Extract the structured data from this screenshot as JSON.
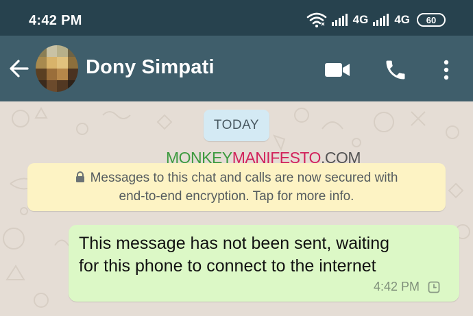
{
  "status_bar": {
    "time": "4:42 PM",
    "network_1": "4G",
    "network_2": "4G",
    "battery": "60",
    "icons": [
      "wifi-icon",
      "signal-icon",
      "signal-icon",
      "battery-icon"
    ]
  },
  "header": {
    "contact_name": "Dony Simpati",
    "icons": [
      "back-arrow-icon",
      "video-call-icon",
      "phone-icon",
      "more-vert-icon"
    ]
  },
  "chat": {
    "date_label": "TODAY",
    "watermark": {
      "part1": "MONKEY",
      "part2": "MANIFESTO",
      "part3": ".COM"
    },
    "encryption_notice": {
      "line1": "Messages to this chat and calls are now secured with",
      "line2": "end-to-end encryption. Tap for more info.",
      "icon": "lock-icon"
    },
    "message": {
      "text_line1": "This message has not been sent, waiting",
      "text_line2": "for this phone to connect to the internet",
      "time": "4:42 PM",
      "status_icon": "clock-icon"
    }
  },
  "colors": {
    "status_bar": "#27424e",
    "app_bar": "#3f5e6b",
    "chat_bg": "#e5ddd5",
    "outgoing_bubble": "#dcf8c6",
    "system_notice": "#fdf3c4",
    "date_chip": "#d4eaf4"
  }
}
